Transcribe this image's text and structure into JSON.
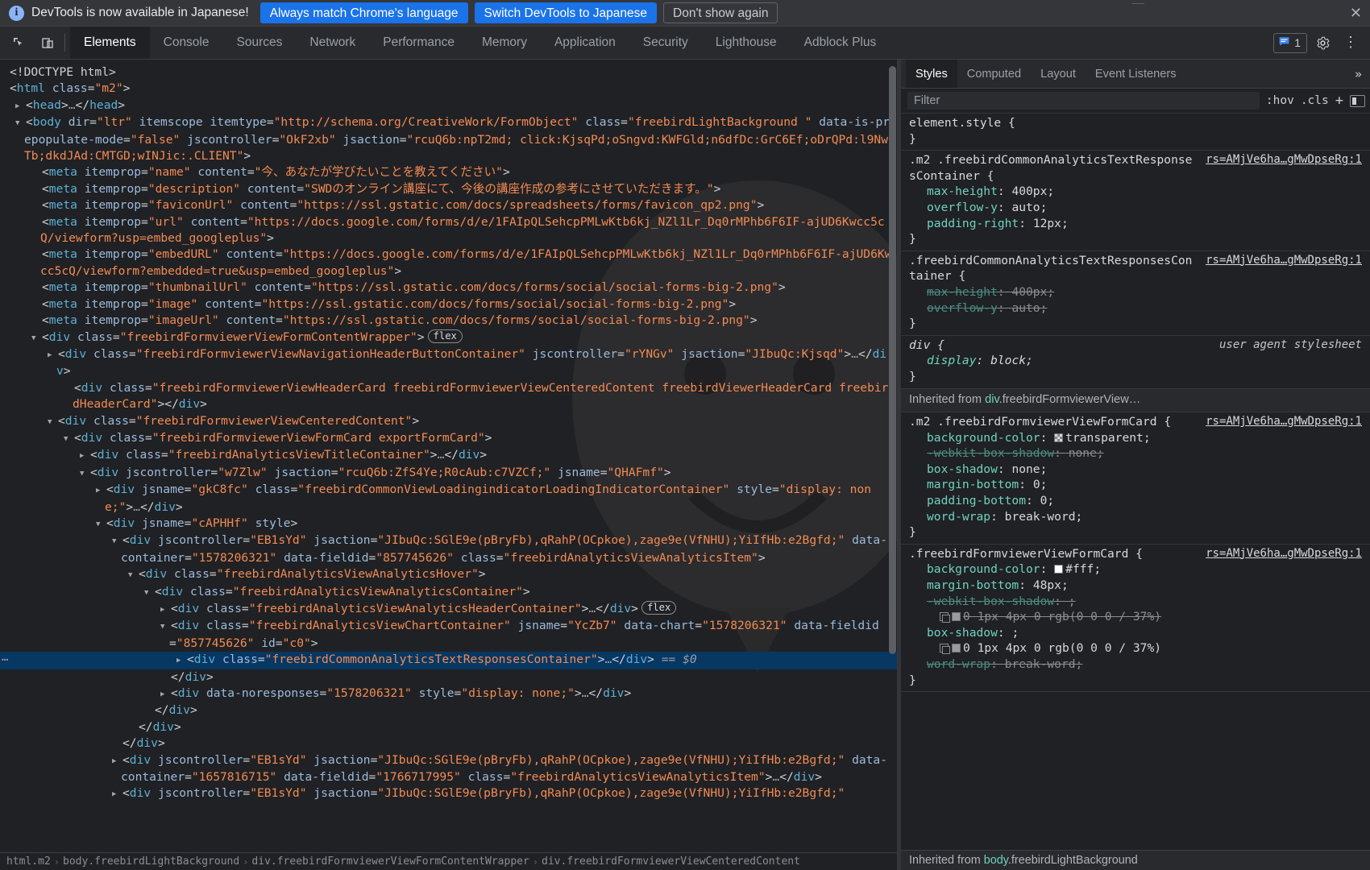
{
  "banner": {
    "icon": "info-icon",
    "message": "DevTools is now available in Japanese!",
    "btn_always": "Always match Chrome's language",
    "btn_switch": "Switch DevTools to Japanese",
    "btn_dismiss": "Don't show again",
    "close": "✕",
    "primary_color": "#1a73e8"
  },
  "toolbar": {
    "inspect_icon": "inspect-element-icon",
    "device_icon": "device-toolbar-icon",
    "tabs": [
      "Elements",
      "Console",
      "Sources",
      "Network",
      "Performance",
      "Memory",
      "Application",
      "Security",
      "Lighthouse",
      "Adblock Plus"
    ],
    "active_tab": "Elements",
    "message_count": "1",
    "message_icon": "chat-bubble-icon",
    "settings_icon": "gear-icon",
    "more_icon": "more-vertical-icon"
  },
  "dom": {
    "selected_marker": "== $0",
    "flex_badge": "flex",
    "nodes": [
      {
        "indent": 0,
        "tri": "",
        "html": "<span class=\"punc\">&lt;!DOCTYPE html&gt;</span>"
      },
      {
        "indent": 0,
        "tri": "",
        "html": "<span class=\"punc\">&lt;</span><span class=\"tag\">html</span> <span class=\"attr\">class</span><span class=\"punc\">=</span><span class=\"val\">\"m2\"</span><span class=\"punc\">&gt;</span>"
      },
      {
        "indent": 1,
        "tri": "▶",
        "html": "<span class=\"punc\">&lt;</span><span class=\"tag\">head</span><span class=\"punc\">&gt;</span><span class=\"ellip\">…</span><span class=\"punc\">&lt;/</span><span class=\"tag\">head</span><span class=\"punc\">&gt;</span>"
      },
      {
        "indent": 1,
        "tri": "▼",
        "html": "<span class=\"punc\">&lt;</span><span class=\"tag\">body</span> <span class=\"attr\">dir</span><span class=\"punc\">=</span><span class=\"val\">\"ltr\"</span> <span class=\"attr\">itemscope</span> <span class=\"attr\">itemtype</span><span class=\"punc\">=</span><span class=\"val\">\"http://schema.org/CreativeWork/FormObject\"</span> <span class=\"attr\">class</span><span class=\"punc\">=</span><span class=\"val\">\"freebirdLightBackground \"</span> <span class=\"attr\">data-is-prepopulate-mode</span><span class=\"punc\">=</span><span class=\"val\">\"false\"</span> <span class=\"attr\">jscontroller</span><span class=\"punc\">=</span><span class=\"val\">\"OkF2xb\"</span> <span class=\"attr\">jsaction</span><span class=\"punc\">=</span><span class=\"val\">\"rcuQ6b:npT2md; click:KjsqPd;oSngvd:KWFGld;n6dfDc:GrC6Ef;oDrQPd:l9NwTb;dkdJAd:CMTGD;wINJic:.CLIENT\"</span><span class=\"punc\">&gt;</span>"
      },
      {
        "indent": 2,
        "tri": "",
        "html": "<span class=\"punc\">&lt;</span><span class=\"tag\">meta</span> <span class=\"attr\">itemprop</span><span class=\"punc\">=</span><span class=\"val\">\"name\"</span> <span class=\"attr\">content</span><span class=\"punc\">=</span><span class=\"val\">\"今、あなたが学びたいことを教えてください\"</span><span class=\"punc\">&gt;</span>"
      },
      {
        "indent": 2,
        "tri": "",
        "html": "<span class=\"punc\">&lt;</span><span class=\"tag\">meta</span> <span class=\"attr\">itemprop</span><span class=\"punc\">=</span><span class=\"val\">\"description\"</span> <span class=\"attr\">content</span><span class=\"punc\">=</span><span class=\"val\">\"SWDのオンライン講座にて、今後の講座作成の参考にさせていただきます。\"</span><span class=\"punc\">&gt;</span>"
      },
      {
        "indent": 2,
        "tri": "",
        "html": "<span class=\"punc\">&lt;</span><span class=\"tag\">meta</span> <span class=\"attr\">itemprop</span><span class=\"punc\">=</span><span class=\"val\">\"faviconUrl\"</span> <span class=\"attr\">content</span><span class=\"punc\">=</span><span class=\"val\">\"https://ssl.gstatic.com/docs/spreadsheets/forms/favicon_qp2.png\"</span><span class=\"punc\">&gt;</span>"
      },
      {
        "indent": 2,
        "tri": "",
        "html": "<span class=\"punc\">&lt;</span><span class=\"tag\">meta</span> <span class=\"attr\">itemprop</span><span class=\"punc\">=</span><span class=\"val\">\"url\"</span> <span class=\"attr\">content</span><span class=\"punc\">=</span><span class=\"val\">\"https://docs.google.com/forms/d/e/1FAIpQLSehcpPMLwKtb6kj_NZl1Lr_Dq0rMPhb6F6IF-ajUD6Kwcc5cQ/viewform?usp=embed_googleplus\"</span><span class=\"punc\">&gt;</span>"
      },
      {
        "indent": 2,
        "tri": "",
        "html": "<span class=\"punc\">&lt;</span><span class=\"tag\">meta</span> <span class=\"attr\">itemprop</span><span class=\"punc\">=</span><span class=\"val\">\"embedURL\"</span> <span class=\"attr\">content</span><span class=\"punc\">=</span><span class=\"val\">\"https://docs.google.com/forms/d/e/1FAIpQLSehcpPMLwKtb6kj_NZl1Lr_Dq0rMPhb6F6IF-ajUD6Kwcc5cQ/viewform?embedded=true&amp;usp=embed_googleplus\"</span><span class=\"punc\">&gt;</span>"
      },
      {
        "indent": 2,
        "tri": "",
        "html": "<span class=\"punc\">&lt;</span><span class=\"tag\">meta</span> <span class=\"attr\">itemprop</span><span class=\"punc\">=</span><span class=\"val\">\"thumbnailUrl\"</span> <span class=\"attr\">content</span><span class=\"punc\">=</span><span class=\"val\">\"https://ssl.gstatic.com/docs/forms/social/social-forms-big-2.png\"</span><span class=\"punc\">&gt;</span>"
      },
      {
        "indent": 2,
        "tri": "",
        "html": "<span class=\"punc\">&lt;</span><span class=\"tag\">meta</span> <span class=\"attr\">itemprop</span><span class=\"punc\">=</span><span class=\"val\">\"image\"</span> <span class=\"attr\">content</span><span class=\"punc\">=</span><span class=\"val\">\"https://ssl.gstatic.com/docs/forms/social/social-forms-big-2.png\"</span><span class=\"punc\">&gt;</span>"
      },
      {
        "indent": 2,
        "tri": "",
        "html": "<span class=\"punc\">&lt;</span><span class=\"tag\">meta</span> <span class=\"attr\">itemprop</span><span class=\"punc\">=</span><span class=\"val\">\"imageUrl\"</span> <span class=\"attr\">content</span><span class=\"punc\">=</span><span class=\"val\">\"https://ssl.gstatic.com/docs/forms/social/social-forms-big-2.png\"</span><span class=\"punc\">&gt;</span>"
      },
      {
        "indent": 2,
        "tri": "▼",
        "flex": true,
        "html": "<span class=\"punc\">&lt;</span><span class=\"tag\">div</span> <span class=\"attr\">class</span><span class=\"punc\">=</span><span class=\"val\">\"freebirdFormviewerViewFormContentWrapper\"</span><span class=\"punc\">&gt;</span>"
      },
      {
        "indent": 3,
        "tri": "▶",
        "html": "<span class=\"punc\">&lt;</span><span class=\"tag\">div</span> <span class=\"attr\">class</span><span class=\"punc\">=</span><span class=\"val\">\"freebirdFormviewerViewNavigationHeaderButtonContainer\"</span> <span class=\"attr\">jscontroller</span><span class=\"punc\">=</span><span class=\"val\">\"rYNGv\"</span> <span class=\"attr\">jsaction</span><span class=\"punc\">=</span><span class=\"val\">\"JIbuQc:Kjsqd\"</span><span class=\"punc\">&gt;</span><span class=\"ellip\">…</span><span class=\"punc\">&lt;/</span><span class=\"tag\">div</span><span class=\"punc\">&gt;</span>"
      },
      {
        "indent": 4,
        "tri": "",
        "html": "<span class=\"punc\">&lt;</span><span class=\"tag\">div</span> <span class=\"attr\">class</span><span class=\"punc\">=</span><span class=\"val\">\"freebirdFormviewerViewHeaderCard freebirdFormviewerViewCenteredContent freebirdViewerHeaderCard freebirdHeaderCard\"</span><span class=\"punc\">&gt;&lt;/</span><span class=\"tag\">div</span><span class=\"punc\">&gt;</span>"
      },
      {
        "indent": 3,
        "tri": "▼",
        "html": "<span class=\"punc\">&lt;</span><span class=\"tag\">div</span> <span class=\"attr\">class</span><span class=\"punc\">=</span><span class=\"val\">\"freebirdFormviewerViewCenteredContent\"</span><span class=\"punc\">&gt;</span>"
      },
      {
        "indent": 4,
        "tri": "▼",
        "html": "<span class=\"punc\">&lt;</span><span class=\"tag\">div</span> <span class=\"attr\">class</span><span class=\"punc\">=</span><span class=\"val\">\"freebirdFormviewerViewFormCard exportFormCard\"</span><span class=\"punc\">&gt;</span>"
      },
      {
        "indent": 5,
        "tri": "▶",
        "html": "<span class=\"punc\">&lt;</span><span class=\"tag\">div</span> <span class=\"attr\">class</span><span class=\"punc\">=</span><span class=\"val\">\"freebirdAnalyticsViewTitleContainer\"</span><span class=\"punc\">&gt;</span><span class=\"ellip\">…</span><span class=\"punc\">&lt;/</span><span class=\"tag\">div</span><span class=\"punc\">&gt;</span>"
      },
      {
        "indent": 5,
        "tri": "▼",
        "html": "<span class=\"punc\">&lt;</span><span class=\"tag\">div</span> <span class=\"attr\">jscontroller</span><span class=\"punc\">=</span><span class=\"val\">\"w7Zlw\"</span> <span class=\"attr\">jsaction</span><span class=\"punc\">=</span><span class=\"val\">\"rcuQ6b:ZfS4Ye;R0cAub:c7VZCf;\"</span> <span class=\"attr\">jsname</span><span class=\"punc\">=</span><span class=\"val\">\"QHAFmf\"</span><span class=\"punc\">&gt;</span>"
      },
      {
        "indent": 6,
        "tri": "▶",
        "html": "<span class=\"punc\">&lt;</span><span class=\"tag\">div</span> <span class=\"attr\">jsname</span><span class=\"punc\">=</span><span class=\"val\">\"gkC8fc\"</span> <span class=\"attr\">class</span><span class=\"punc\">=</span><span class=\"val\">\"freebirdCommonViewLoadingindicatorLoadingIndicatorContainer\"</span> <span class=\"attr\">style</span><span class=\"punc\">=</span><span class=\"val\">\"display: none;\"</span><span class=\"punc\">&gt;</span><span class=\"ellip\">…</span><span class=\"punc\">&lt;/</span><span class=\"tag\">div</span><span class=\"punc\">&gt;</span>"
      },
      {
        "indent": 6,
        "tri": "▼",
        "html": "<span class=\"punc\">&lt;</span><span class=\"tag\">div</span> <span class=\"attr\">jsname</span><span class=\"punc\">=</span><span class=\"val\">\"cAPHHf\"</span> <span class=\"attr\">style</span><span class=\"punc\">&gt;</span>"
      },
      {
        "indent": 7,
        "tri": "▼",
        "html": "<span class=\"punc\">&lt;</span><span class=\"tag\">div</span> <span class=\"attr\">jscontroller</span><span class=\"punc\">=</span><span class=\"val\">\"EB1sYd\"</span> <span class=\"attr\">jsaction</span><span class=\"punc\">=</span><span class=\"val\">\"JIbuQc:SGlE9e(pBryFb),qRahP(OCpkoe),zage9e(VfNHU);YiIfHb:e2Bgfd;\"</span> <span class=\"attr\">data-container</span><span class=\"punc\">=</span><span class=\"val\">\"1578206321\"</span> <span class=\"attr\">data-fieldid</span><span class=\"punc\">=</span><span class=\"val\">\"857745626\"</span> <span class=\"attr\">class</span><span class=\"punc\">=</span><span class=\"val\">\"freebirdAnalyticsViewAnalyticsItem\"</span><span class=\"punc\">&gt;</span>"
      },
      {
        "indent": 8,
        "tri": "▼",
        "html": "<span class=\"punc\">&lt;</span><span class=\"tag\">div</span> <span class=\"attr\">class</span><span class=\"punc\">=</span><span class=\"val\">\"freebirdAnalyticsViewAnalyticsHover\"</span><span class=\"punc\">&gt;</span>"
      },
      {
        "indent": 9,
        "tri": "▼",
        "html": "<span class=\"punc\">&lt;</span><span class=\"tag\">div</span> <span class=\"attr\">class</span><span class=\"punc\">=</span><span class=\"val\">\"freebirdAnalyticsViewAnalyticsContainer\"</span><span class=\"punc\">&gt;</span>"
      },
      {
        "indent": 10,
        "tri": "▶",
        "flex": true,
        "html": "<span class=\"punc\">&lt;</span><span class=\"tag\">div</span> <span class=\"attr\">class</span><span class=\"punc\">=</span><span class=\"val\">\"freebirdAnalyticsViewAnalyticsHeaderContainer\"</span><span class=\"punc\">&gt;</span><span class=\"ellip\">…</span><span class=\"punc\">&lt;/</span><span class=\"tag\">div</span><span class=\"punc\">&gt;</span>"
      },
      {
        "indent": 10,
        "tri": "▼",
        "html": "<span class=\"punc\">&lt;</span><span class=\"tag\">div</span> <span class=\"attr\">class</span><span class=\"punc\">=</span><span class=\"val\">\"freebirdAnalyticsViewChartContainer\"</span> <span class=\"attr\">jsname</span><span class=\"punc\">=</span><span class=\"val\">\"YcZb7\"</span> <span class=\"attr\">data-chart</span><span class=\"punc\">=</span><span class=\"val\">\"1578206321\"</span> <span class=\"attr\">data-fieldid</span><span class=\"punc\">=</span><span class=\"val\">\"857745626\"</span> <span class=\"attr\">id</span><span class=\"punc\">=</span><span class=\"val\">\"c0\"</span><span class=\"punc\">&gt;</span>"
      },
      {
        "indent": 11,
        "tri": "▶",
        "selected": true,
        "html": "<span class=\"punc\">&lt;</span><span class=\"tag\">div</span> <span class=\"attr\">class</span><span class=\"punc\">=</span><span class=\"val\">\"freebirdCommonAnalyticsTextResponsesContainer\"</span><span class=\"punc\">&gt;</span><span class=\"ellip\">…</span><span class=\"punc\">&lt;/</span><span class=\"tag\">div</span><span class=\"punc\">&gt;</span> <span class=\"eqdollar\">== $0</span>"
      },
      {
        "indent": 10,
        "tri": "",
        "html": "<span class=\"punc\">&lt;/</span><span class=\"tag\">div</span><span class=\"punc\">&gt;</span>"
      },
      {
        "indent": 10,
        "tri": "▶",
        "html": "<span class=\"punc\">&lt;</span><span class=\"tag\">div</span> <span class=\"attr\">data-noresponses</span><span class=\"punc\">=</span><span class=\"val\">\"1578206321\"</span> <span class=\"attr\">style</span><span class=\"punc\">=</span><span class=\"val\">\"display: none;\"</span><span class=\"punc\">&gt;</span><span class=\"ellip\">…</span><span class=\"punc\">&lt;/</span><span class=\"tag\">div</span><span class=\"punc\">&gt;</span>"
      },
      {
        "indent": 9,
        "tri": "",
        "html": "<span class=\"punc\">&lt;/</span><span class=\"tag\">div</span><span class=\"punc\">&gt;</span>"
      },
      {
        "indent": 8,
        "tri": "",
        "html": "<span class=\"punc\">&lt;/</span><span class=\"tag\">div</span><span class=\"punc\">&gt;</span>"
      },
      {
        "indent": 7,
        "tri": "",
        "html": "<span class=\"punc\">&lt;/</span><span class=\"tag\">div</span><span class=\"punc\">&gt;</span>"
      },
      {
        "indent": 7,
        "tri": "▶",
        "html": "<span class=\"punc\">&lt;</span><span class=\"tag\">div</span> <span class=\"attr\">jscontroller</span><span class=\"punc\">=</span><span class=\"val\">\"EB1sYd\"</span> <span class=\"attr\">jsaction</span><span class=\"punc\">=</span><span class=\"val\">\"JIbuQc:SGlE9e(pBryFb),qRahP(OCpkoe),zage9e(VfNHU);YiIfHb:e2Bgfd;\"</span> <span class=\"attr\">data-container</span><span class=\"punc\">=</span><span class=\"val\">\"1657816715\"</span> <span class=\"attr\">data-fieldid</span><span class=\"punc\">=</span><span class=\"val\">\"1766717995\"</span> <span class=\"attr\">class</span><span class=\"punc\">=</span><span class=\"val\">\"freebirdAnalyticsViewAnalyticsItem\"</span><span class=\"punc\">&gt;</span><span class=\"ellip\">…</span><span class=\"punc\">&lt;/</span><span class=\"tag\">div</span><span class=\"punc\">&gt;</span>"
      },
      {
        "indent": 7,
        "tri": "▶",
        "html": "<span class=\"punc\">&lt;</span><span class=\"tag\">div</span> <span class=\"attr\">jscontroller</span><span class=\"punc\">=</span><span class=\"val\">\"EB1sYd\"</span> <span class=\"attr\">jsaction</span><span class=\"punc\">=</span><span class=\"val\">\"JIbuQc:SGlE9e(pBryFb),qRahP(OCpkoe),zage9e(VfNHU);YiIfHb:e2Bgfd;\"</span>"
      }
    ],
    "breadcrumb": [
      "html.m2",
      "body.freebirdLightBackground",
      "div.freebirdFormviewerViewFormContentWrapper",
      "div.freebirdFormviewerViewCenteredContent"
    ]
  },
  "styles": {
    "tabs": [
      "Styles",
      "Computed",
      "Layout",
      "Event Listeners"
    ],
    "active_tab": "Styles",
    "more": "»",
    "filter_placeholder": "Filter",
    "hov": ":hov",
    "cls": ".cls",
    "plus": "+",
    "panel_icon": "toggle-sidebar-icon",
    "rules": [
      {
        "selector": "element.style",
        "origin": "",
        "origin_link": false,
        "declarations": []
      },
      {
        "selector": ".m2 .freebirdCommonAnalyticsTextResponsesContainer",
        "origin": "rs=AMjVe6ha…gMwDpseRg:1",
        "origin_link": true,
        "declarations": [
          {
            "prop": "max-height",
            "value": "400px",
            "inactive": false
          },
          {
            "prop": "overflow-y",
            "value": "auto",
            "inactive": false
          },
          {
            "prop": "padding-right",
            "value": "12px",
            "inactive": false
          }
        ]
      },
      {
        "selector": ".freebirdCommonAnalyticsTextResponsesContainer",
        "origin": "rs=AMjVe6ha…gMwDpseRg:1",
        "origin_link": true,
        "declarations": [
          {
            "prop": "max-height",
            "value": "400px",
            "inactive": true
          },
          {
            "prop": "overflow-y",
            "value": "auto",
            "inactive": true
          }
        ]
      },
      {
        "selector": "div",
        "origin": "user agent stylesheet",
        "origin_link": false,
        "ua": true,
        "declarations": [
          {
            "prop": "display",
            "value": "block",
            "inactive": false,
            "italic": true
          }
        ]
      }
    ],
    "inherited_label": "Inherited from",
    "inherited_from": "div.freebirdFormviewerView…",
    "inherited_rules": [
      {
        "selector": ".m2 .freebirdFormviewerViewFormCard",
        "origin": "rs=AMjVe6ha…gMwDpseRg:1",
        "origin_link": true,
        "declarations": [
          {
            "prop": "background-color",
            "value": "transparent",
            "swatch": "checker",
            "inactive": false
          },
          {
            "prop": "-webkit-box-shadow",
            "value": "none",
            "inactive": true
          },
          {
            "prop": "box-shadow",
            "value": "none",
            "inactive": false
          },
          {
            "prop": "margin-bottom",
            "value": "0",
            "inactive": false
          },
          {
            "prop": "padding-bottom",
            "value": "0",
            "inactive": false
          },
          {
            "prop": "word-wrap",
            "value": "break-word",
            "inactive": false
          }
        ]
      },
      {
        "selector": ".freebirdFormviewerViewFormCard",
        "origin": "rs=AMjVe6ha…gMwDpseRg:1",
        "origin_link": true,
        "declarations": [
          {
            "prop": "background-color",
            "value": "#fff",
            "swatch": "white",
            "inactive": false
          },
          {
            "prop": "margin-bottom",
            "value": "48px",
            "inactive": false
          },
          {
            "prop": "-webkit-box-shadow",
            "value": "",
            "inactive": true
          },
          {
            "prop": "",
            "value": "0 1px 4px 0 rgb(0 0 0 / 37%)",
            "swatch": "gray37",
            "shadow": true,
            "inactive": true
          },
          {
            "prop": "box-shadow",
            "value": "",
            "inactive": false
          },
          {
            "prop": "",
            "value": "0 1px 4px 0 rgb(0 0 0 / 37%)",
            "swatch": "gray37",
            "shadow": true,
            "inactive": false
          },
          {
            "prop": "word-wrap",
            "value": "break-word",
            "inactive": true
          }
        ]
      }
    ],
    "footer_label": "Inherited from",
    "footer_from": "body.freebirdLightBackground"
  }
}
